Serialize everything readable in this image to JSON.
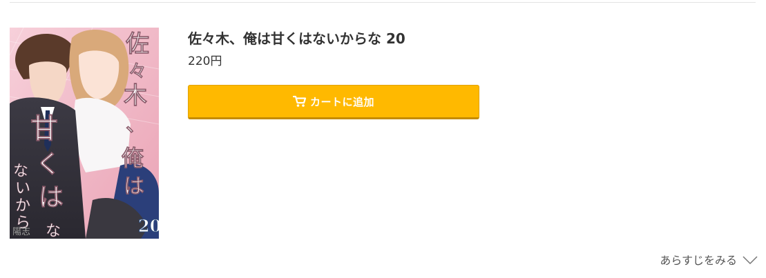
{
  "product": {
    "title": "佐々木、俺は甘くはないからな 20",
    "price": "220円",
    "cover": {
      "title_text": "佐々木、俺は甘くはないからな",
      "volume": "20",
      "author": "陽志"
    }
  },
  "actions": {
    "add_to_cart_label": "カートに追加",
    "cart_icon": "cart-icon"
  },
  "synopsis": {
    "link_label": "あらすじをみる",
    "icon": "chevron-down-icon"
  },
  "colors": {
    "button_bg": "#ffb900",
    "button_text": "#ffffff",
    "title_text": "#333333"
  }
}
